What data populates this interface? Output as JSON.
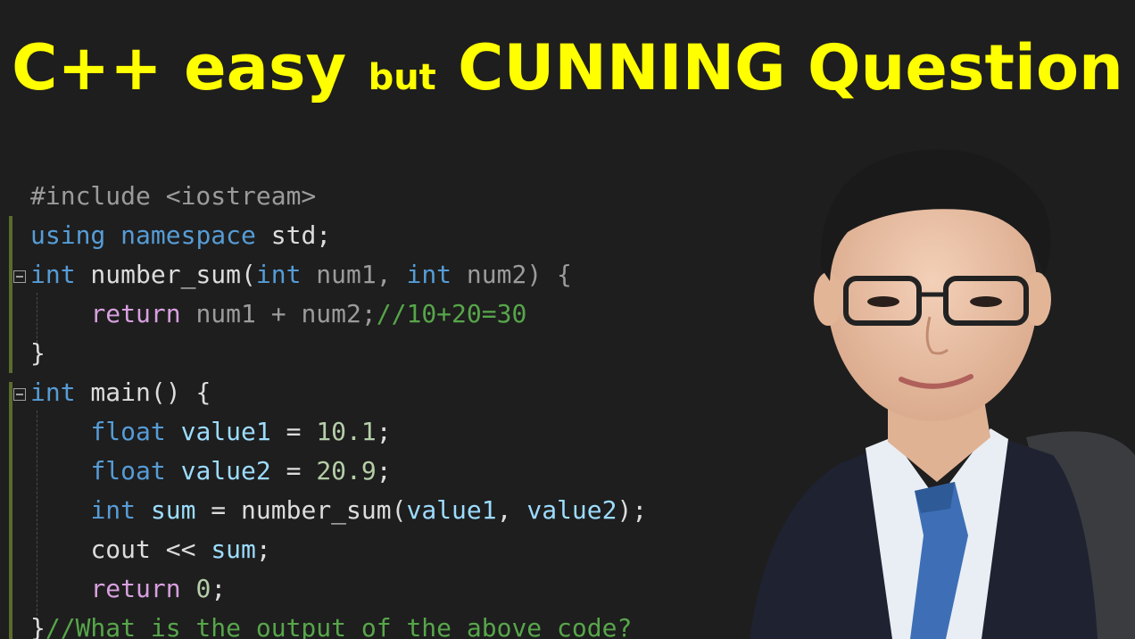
{
  "title": {
    "part1": "C++ easy",
    "part2": "but",
    "part3": "CUNNING Question"
  },
  "code": {
    "line1": "#include <iostream>",
    "line2_a": "using",
    "line2_b": "namespace",
    "line2_c": " std;",
    "line3_a": "int",
    "line3_b": " number_sum(",
    "line3_c": "int",
    "line3_d": " num1, ",
    "line3_e": "int",
    "line3_f": " num2) {",
    "line4_a": "return",
    "line4_b": " num1 + num2;",
    "line4_c": "//10+20=30",
    "line5": "}",
    "line6_a": "int",
    "line6_b": " main() {",
    "line7_a": "float",
    "line7_b": " value1",
    "line7_c": " = ",
    "line7_d": "10.1",
    "line7_e": ";",
    "line8_a": "float",
    "line8_b": " value2",
    "line8_c": " = ",
    "line8_d": "20.9",
    "line8_e": ";",
    "line9_a": "int",
    "line9_b": " sum",
    "line9_c": " = number_sum(",
    "line9_d": "value1",
    "line9_e": ", ",
    "line9_f": "value2",
    "line9_g": ");",
    "line10_a": "cout",
    "line10_b": " << ",
    "line10_c": "sum",
    "line10_d": ";",
    "line11_a": "return",
    "line11_b": " ",
    "line11_c": "0",
    "line11_d": ";",
    "line12_a": "}",
    "line12_b": "//What is the output of the above code?"
  },
  "icons": {
    "fold": "collapse-icon",
    "photo": "presenter-photo"
  },
  "colors": {
    "title": "#ffff00",
    "background": "#1e1e1e",
    "keyword": "#569cd6",
    "control": "#d8a0df",
    "comment": "#57a64a",
    "number": "#b5cea8"
  }
}
